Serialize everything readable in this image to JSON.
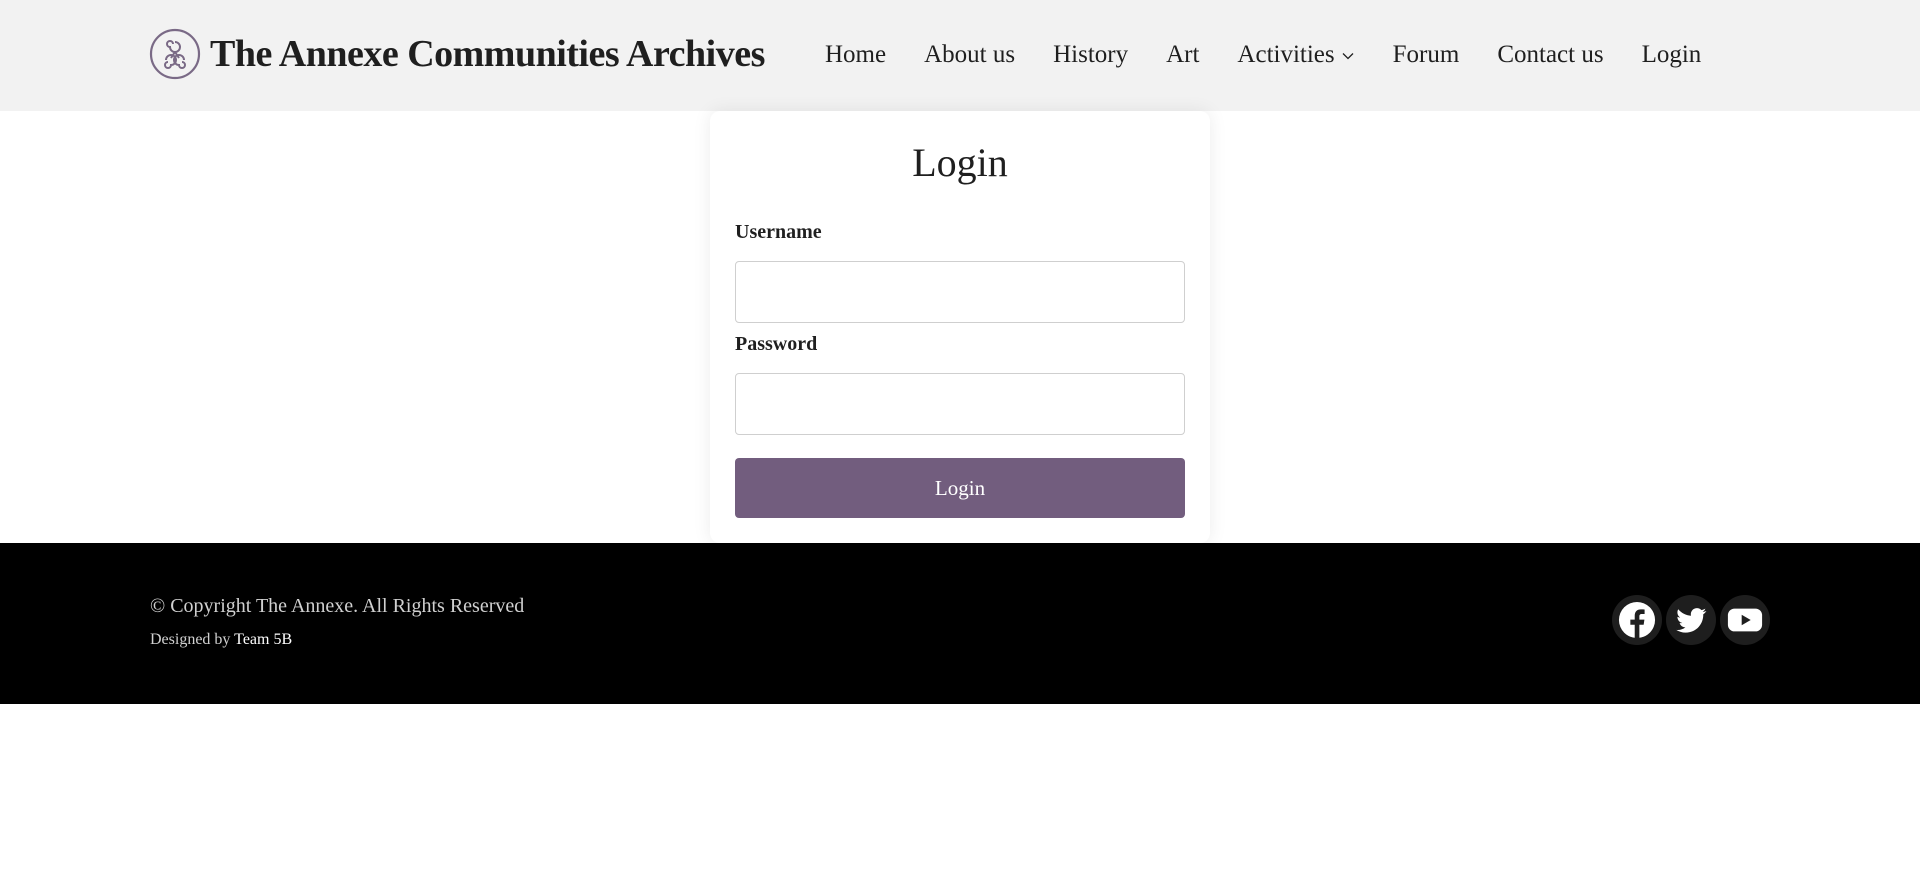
{
  "header": {
    "site_title": "The Annexe Communities Archives",
    "logo_icon": "triskele-spiral-icon",
    "nav": [
      {
        "label": "Home"
      },
      {
        "label": "About us"
      },
      {
        "label": "History"
      },
      {
        "label": "Art"
      },
      {
        "label": "Activities",
        "has_dropdown": true
      },
      {
        "label": "Forum"
      },
      {
        "label": "Contact us"
      },
      {
        "label": "Login"
      }
    ]
  },
  "login_form": {
    "title": "Login",
    "username_label": "Username",
    "username_value": "",
    "password_label": "Password",
    "password_value": "",
    "submit_label": "Login"
  },
  "footer": {
    "copyright": "© Copyright The Annexe. All Rights Reserved",
    "designed_by_prefix": "Designed by",
    "designed_by_team": "Team 5B",
    "socials": [
      {
        "icon": "facebook-icon"
      },
      {
        "icon": "twitter-icon"
      },
      {
        "icon": "youtube-icon"
      }
    ]
  },
  "colors": {
    "header_bg": "#f2f2f2",
    "accent": "#725d7e",
    "footer_bg": "#000000"
  }
}
